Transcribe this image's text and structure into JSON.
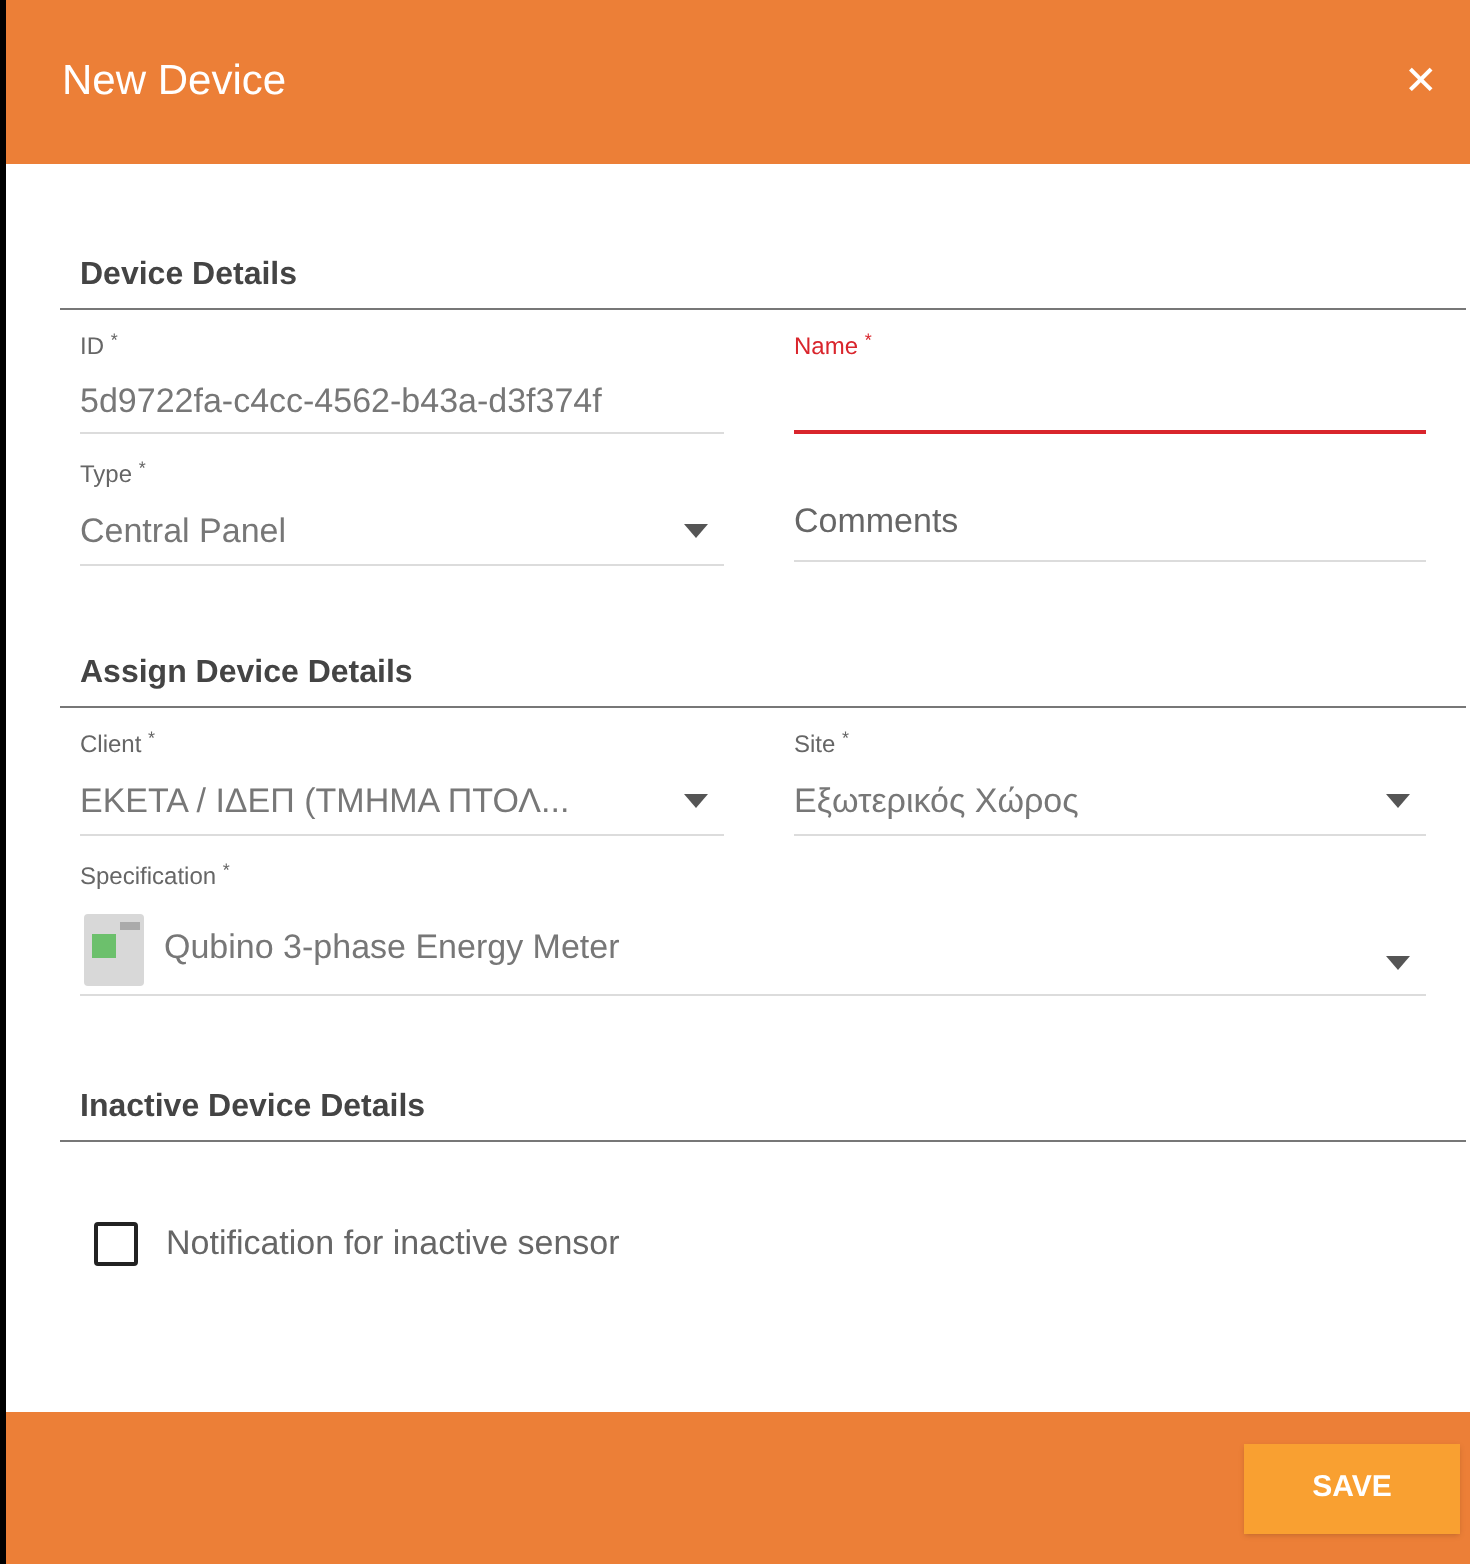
{
  "dialog": {
    "title": "New Device",
    "close": "✕"
  },
  "sections": [
    {
      "title": "Device Details",
      "fields": [
        {
          "kind": "text",
          "label": "ID $^{*}$",
          "value": "5d9722fa-c4cc-4562-b43a-d3f374f",
          "invalid": false,
          "wide": false
        },
        {
          "kind": "text",
          "label": "Name $^{*}$",
          "invalid": true,
          "wide": false
        },
        {
          "kind": "select",
          "label": "Type $^{*}$",
          "value": "Central Panel",
          "invalid": false,
          "wide": false
        },
        {
          "kind": "placeholder",
          "placeholder": "Comments",
          "invalid": false,
          "wide": false
        }
      ]
    },
    {
      "title": "Assign Device Details",
      "fields": [
        {
          "kind": "select",
          "label": "Client $^{*}$",
          "value": "ΕΚΕΤΑ / ΙΔΕΠ (ΤΜΗΜΑ ΠΤΟΛ...",
          "invalid": false,
          "wide": false
        },
        {
          "kind": "select",
          "label": "Site $^{*}$",
          "value": "Εξωτερικός Χώρος",
          "invalid": false,
          "wide": false
        },
        {
          "kind": "select",
          "label": "Specification $^{*}$",
          "value": "Qubino 3-phase Energy Meter",
          "invalid": false,
          "wide": true,
          "image": true
        }
      ]
    },
    {
      "title": "Inactive Device Details",
      "checkboxes": [
        {
          "label": "Notification for inactive sensor",
          "checked": false
        }
      ]
    }
  ],
  "save": "SAVE"
}
